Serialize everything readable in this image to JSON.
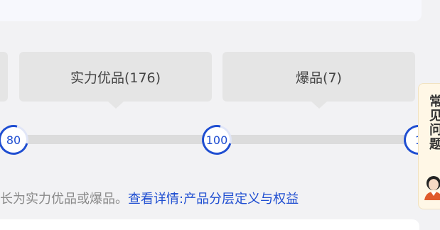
{
  "tiers": [
    {
      "label": ""
    },
    {
      "label": "实力优品(176)"
    },
    {
      "label": "爆品(7)"
    }
  ],
  "markers": [
    "80",
    "100",
    "1"
  ],
  "note": {
    "text": "长为实力优品或爆品。",
    "link": "查看详情:产品分层定义与权益"
  },
  "faq": {
    "label": "常见问题"
  },
  "colors": {
    "accent": "#1f4ed1",
    "tier_bg": "#e5e5e5",
    "track": "#dcdcdc"
  }
}
